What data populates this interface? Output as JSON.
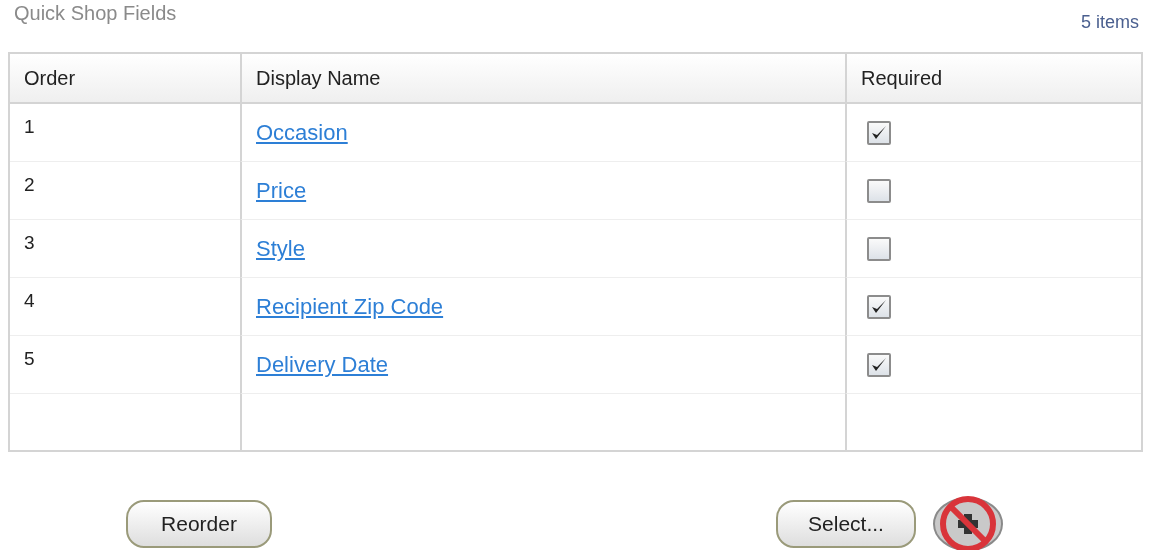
{
  "title": "Quick Shop Fields",
  "item_count": "5 items",
  "table": {
    "columns": [
      "Order",
      "Display Name",
      "Required"
    ],
    "rows": [
      {
        "order": "1",
        "name": "Occasion",
        "required": true
      },
      {
        "order": "2",
        "name": "Price",
        "required": false
      },
      {
        "order": "3",
        "name": "Style",
        "required": false
      },
      {
        "order": "4",
        "name": "Recipient Zip Code",
        "required": true
      },
      {
        "order": "5",
        "name": "Delivery Date",
        "required": true
      }
    ]
  },
  "buttons": {
    "reorder": "Reorder",
    "select": "Select...",
    "add_disabled": true
  }
}
